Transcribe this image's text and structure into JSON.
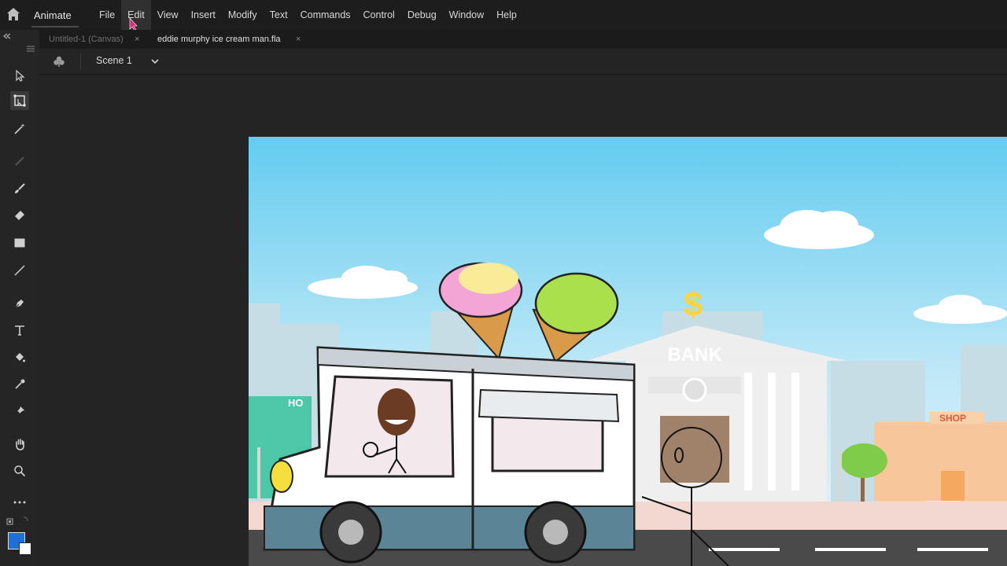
{
  "app": {
    "name": "Animate"
  },
  "menu": {
    "items": [
      "File",
      "Edit",
      "View",
      "Insert",
      "Modify",
      "Text",
      "Commands",
      "Control",
      "Debug",
      "Window",
      "Help"
    ],
    "active": "Edit"
  },
  "tabs": [
    {
      "label": "Untitled-1 (Canvas)",
      "active": false
    },
    {
      "label": "eddie murphy ice cream man.fla",
      "active": true
    }
  ],
  "scene": {
    "label": "Scene 1"
  },
  "toolbar": {
    "tools": [
      "selection-tool",
      "free-transform-tool",
      "magic-wand-tool",
      "bone-tool",
      "paint-brush-tool",
      "eraser-tool",
      "rectangle-tool",
      "line-tool",
      "pen-tool",
      "text-tool",
      "paint-bucket-tool",
      "eyedropper-tool",
      "pin-tool",
      "hand-tool",
      "zoom-tool",
      "more-tools"
    ],
    "selected": "free-transform-tool",
    "fill_color": "#1e6fd9"
  },
  "stage_content": {
    "bank_sign": "BANK",
    "dollar_sign": "$",
    "shop_sign": "SHOP",
    "hotel_sign_partial": "HO"
  },
  "colors": {
    "sky_top": "#63ccef",
    "sky_bottom": "#d8f1fb",
    "ui_bg": "#1d1d1d"
  }
}
